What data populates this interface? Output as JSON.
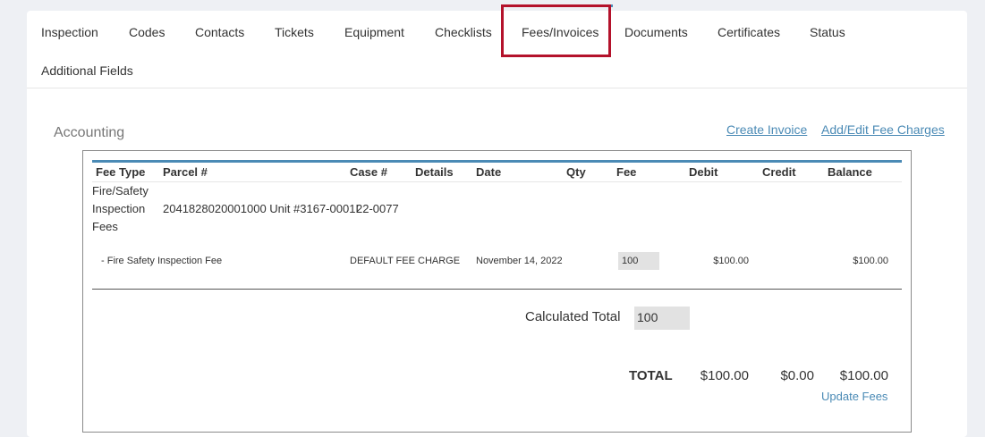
{
  "tabs": [
    {
      "label": "Inspection"
    },
    {
      "label": "Codes"
    },
    {
      "label": "Contacts"
    },
    {
      "label": "Tickets"
    },
    {
      "label": "Equipment"
    },
    {
      "label": "Checklists"
    },
    {
      "label": "Fees/Invoices",
      "active": true
    },
    {
      "label": "Documents"
    },
    {
      "label": "Certificates"
    },
    {
      "label": "Status"
    },
    {
      "label": "Additional Fields"
    }
  ],
  "accounting": {
    "title": "Accounting",
    "create_invoice": "Create Invoice",
    "add_edit_fee": "Add/Edit Fee Charges",
    "columns": [
      "Fee Type",
      "Parcel #",
      "Case #",
      "Details",
      "Date",
      "Qty",
      "Fee",
      "Debit",
      "Credit",
      "Balance"
    ],
    "group": {
      "fee_type_lines": [
        "Fire/Safety",
        "Inspection",
        "Fees"
      ],
      "parcel": "2041828020001000 Unit #3167-0001I",
      "case": "22-0077"
    },
    "line_item": {
      "name": "- Fire Safety Inspection Fee",
      "details": "DEFAULT FEE CHARGE",
      "date": "November 14, 2022",
      "fee_value": "100",
      "debit": "$100.00",
      "balance": "$100.00"
    },
    "calculated_total_label": "Calculated Total",
    "calculated_total_value": "100",
    "total_label": "TOTAL",
    "total_debit": "$100.00",
    "total_credit": "$0.00",
    "total_balance": "$100.00",
    "update_fees": "Update Fees"
  },
  "colors": {
    "accent": "#4a8ab5",
    "highlight": "#b4122b"
  }
}
